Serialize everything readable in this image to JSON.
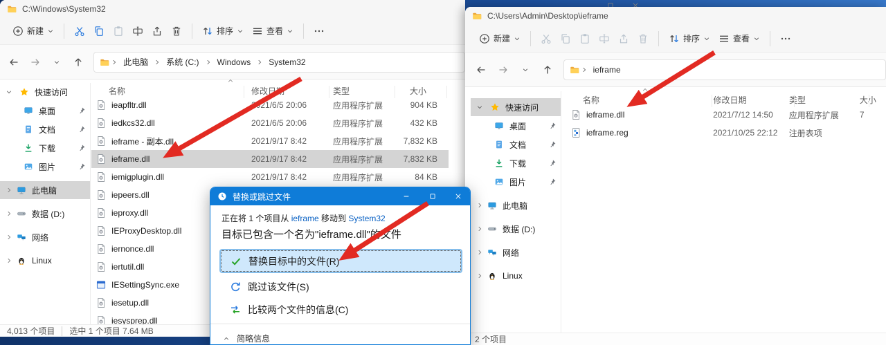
{
  "colors": {
    "accent": "#0f7cd8",
    "arrow_red": "#e22a22",
    "selection_gray": "#d4d4d4",
    "link_blue": "#0b62c4",
    "check_green": "#27a327"
  },
  "toolbar": {
    "new": "新建",
    "sort": "排序",
    "view": "查看"
  },
  "sidebar": {
    "quick_access_label": "快速访问",
    "pinned": [
      {
        "label": "桌面",
        "icon": "desktop"
      },
      {
        "label": "文档",
        "icon": "docs"
      },
      {
        "label": "下载",
        "icon": "download"
      },
      {
        "label": "图片",
        "icon": "pictures"
      }
    ],
    "roots": [
      {
        "label": "此电脑",
        "icon": "pc"
      },
      {
        "label": "数据 (D:)",
        "icon": "drive"
      },
      {
        "label": "网络",
        "icon": "network"
      },
      {
        "label": "Linux",
        "icon": "linux"
      }
    ],
    "left_selected": "此电脑",
    "right_selected": "快速访问"
  },
  "columns": {
    "name": "名称",
    "date": "修改日期",
    "type": "类型",
    "size": "大小"
  },
  "left_window": {
    "title": "C:\\Windows\\System32",
    "breadcrumb": [
      "此电脑",
      "系统 (C:)",
      "Windows",
      "System32"
    ],
    "files": [
      {
        "name": "ieapfltr.dll",
        "date": "2021/6/5 20:06",
        "type": "应用程序扩展",
        "size": "904 KB",
        "icon": "dll",
        "selected": false
      },
      {
        "name": "iedkcs32.dll",
        "date": "2021/6/5 20:06",
        "type": "应用程序扩展",
        "size": "432 KB",
        "icon": "dll",
        "selected": false
      },
      {
        "name": "ieframe - 副本.dll",
        "date": "2021/9/17 8:42",
        "type": "应用程序扩展",
        "size": "7,832 KB",
        "icon": "dll",
        "selected": false
      },
      {
        "name": "ieframe.dll",
        "date": "2021/9/17 8:42",
        "type": "应用程序扩展",
        "size": "7,832 KB",
        "icon": "dll",
        "selected": true
      },
      {
        "name": "iemigplugin.dll",
        "date": "2021/9/17 8:42",
        "type": "应用程序扩展",
        "size": "84 KB",
        "icon": "dll",
        "selected": false
      },
      {
        "name": "iepeers.dll",
        "date": "",
        "type": "",
        "size": "",
        "icon": "dll",
        "selected": false
      },
      {
        "name": "ieproxy.dll",
        "date": "",
        "type": "",
        "size": "",
        "icon": "dll",
        "selected": false
      },
      {
        "name": "IEProxyDesktop.dll",
        "date": "",
        "type": "",
        "size": "",
        "icon": "dll",
        "selected": false
      },
      {
        "name": "iernonce.dll",
        "date": "",
        "type": "",
        "size": "",
        "icon": "dll",
        "selected": false
      },
      {
        "name": "iertutil.dll",
        "date": "",
        "type": "",
        "size": "",
        "icon": "dll",
        "selected": false
      },
      {
        "name": "IESettingSync.exe",
        "date": "",
        "type": "",
        "size": "",
        "icon": "exe",
        "selected": false
      },
      {
        "name": "iesetup.dll",
        "date": "",
        "type": "",
        "size": "",
        "icon": "dll",
        "selected": false
      },
      {
        "name": "iesysprep.dll",
        "date": "",
        "type": "",
        "size": "",
        "icon": "dll",
        "selected": false
      }
    ],
    "status_count": "4,013 个项目",
    "status_selected": "选中 1 个项目  7.64 MB"
  },
  "right_window": {
    "title": "C:\\Users\\Admin\\Desktop\\ieframe",
    "breadcrumb": [
      "ieframe"
    ],
    "files": [
      {
        "name": "ieframe.dll",
        "date": "2021/7/12 14:50",
        "type": "应用程序扩展",
        "size": "7",
        "icon": "dll",
        "selected": false
      },
      {
        "name": "ieframe.reg",
        "date": "2021/10/25 22:12",
        "type": "注册表项",
        "size": "",
        "icon": "reg",
        "selected": false
      }
    ],
    "status_count": "2 个项目"
  },
  "dialog": {
    "title": "替换或跳过文件",
    "progress_prefix": "正在将 1 个项目从 ",
    "progress_source": "ieframe",
    "progress_middle": " 移动到 ",
    "progress_dest": "System32",
    "conflict_text": "目标已包含一个名为\"ieframe.dll\"的文件",
    "options": [
      {
        "label": "替换目标中的文件(R)",
        "icon": "check",
        "selected": true
      },
      {
        "label": "跳过该文件(S)",
        "icon": "skip",
        "selected": false
      },
      {
        "label": "比较两个文件的信息(C)",
        "icon": "compare",
        "selected": false
      }
    ],
    "details_toggle": "简略信息"
  }
}
